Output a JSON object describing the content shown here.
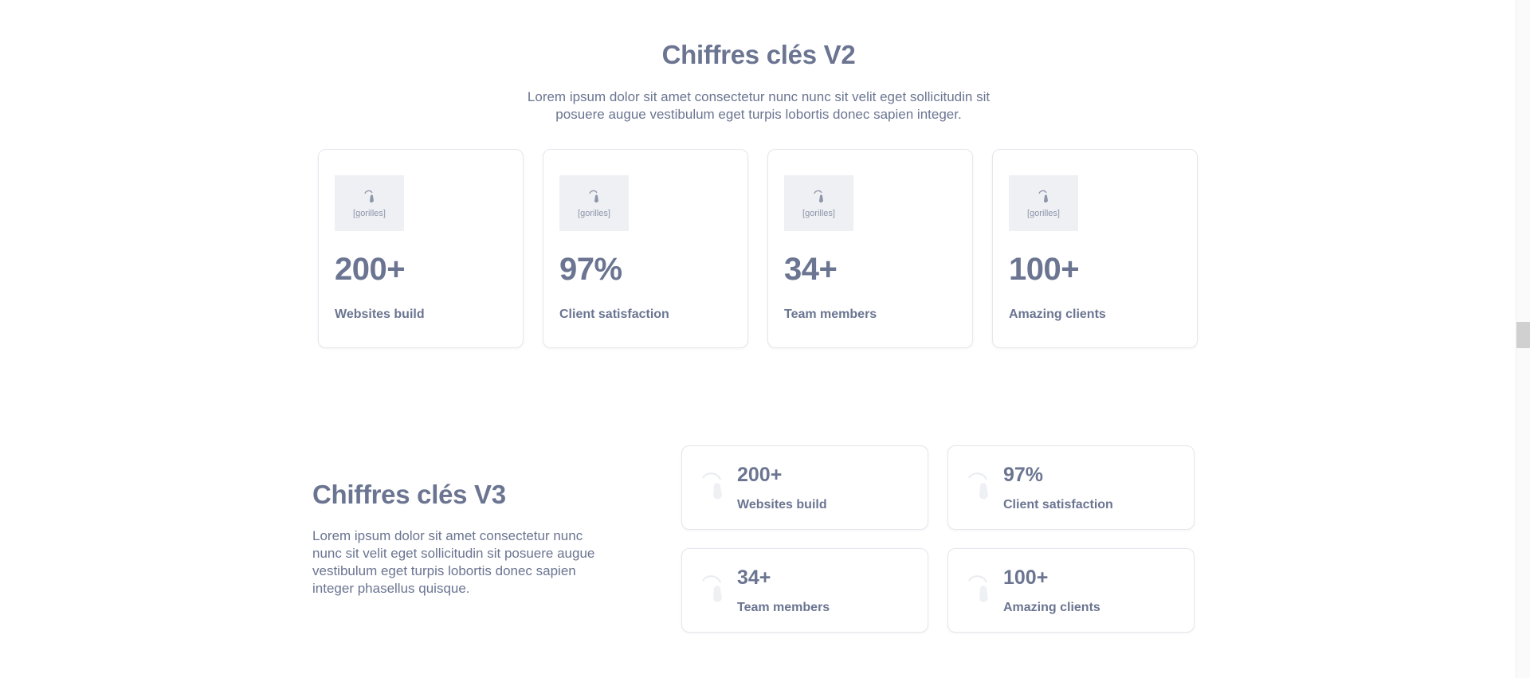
{
  "v2": {
    "title": "Chiffres clés V2",
    "description": "Lorem ipsum dolor sit amet consectetur nunc nunc sit velit eget sollicitudin sit posuere augue vestibulum eget turpis lobortis donec sapien integer.",
    "logo_text": "[gorilles]",
    "cards": [
      {
        "value": "200+",
        "label": "Websites build"
      },
      {
        "value": "97%",
        "label": "Client satisfaction"
      },
      {
        "value": "34+",
        "label": "Team members"
      },
      {
        "value": "100+",
        "label": "Amazing clients"
      }
    ]
  },
  "v3": {
    "title": "Chiffres clés V3",
    "description": "Lorem ipsum dolor sit amet consectetur nunc nunc sit velit eget sollicitudin sit posuere augue vestibulum eget turpis lobortis donec sapien integer phasellus quisque.",
    "cards": [
      {
        "value": "200+",
        "label": "Websites build"
      },
      {
        "value": "97%",
        "label": "Client satisfaction"
      },
      {
        "value": "34+",
        "label": "Team members"
      },
      {
        "value": "100+",
        "label": "Amazing clients"
      }
    ]
  },
  "icons": {
    "logo": "gorilla-logo-icon"
  },
  "colors": {
    "text": "#6b7591",
    "border": "#e4e7ec",
    "logo_bg": "#eef0f4"
  }
}
